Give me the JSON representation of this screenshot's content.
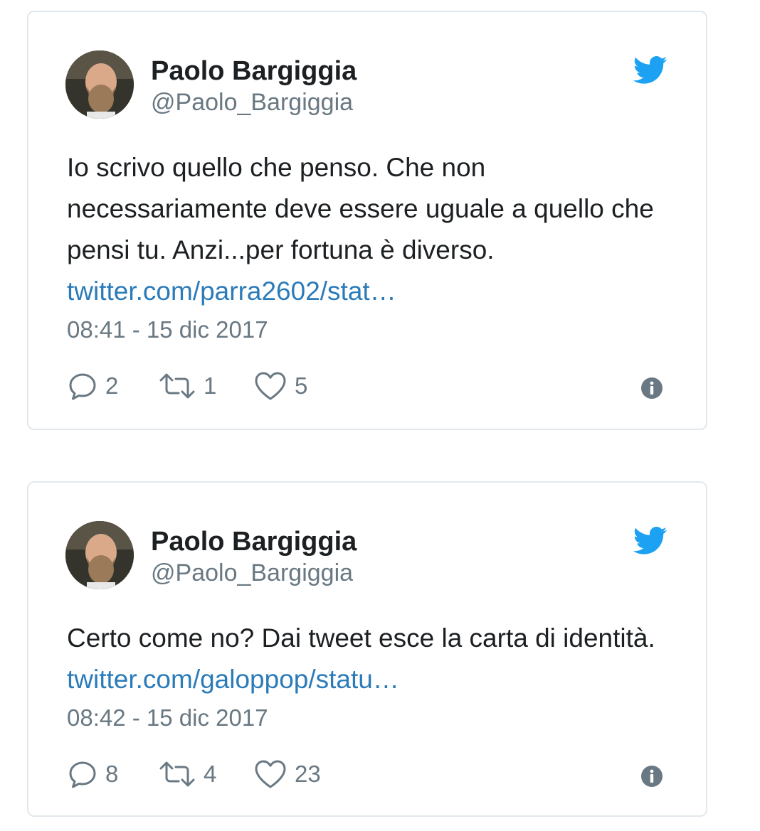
{
  "colors": {
    "link": "#2b7bb9",
    "muted": "#697882",
    "twitter_blue": "#1da1f2",
    "border": "#e1e8ed"
  },
  "tweets": [
    {
      "author": {
        "name": "Paolo Bargiggia",
        "handle": "@Paolo_Bargiggia"
      },
      "text": "Io scrivo quello che penso. Che non necessariamente deve essere uguale a quello che pensi tu. Anzi...per fortuna è diverso.",
      "link": "twitter.com/parra2602/stat…",
      "timestamp": "08:41 - 15 dic 2017",
      "replies": "2",
      "retweets": "1",
      "likes": "5",
      "icons": {
        "brand": "twitter-bird-icon",
        "reply": "reply-bubble-icon",
        "retweet": "retweet-icon",
        "like": "heart-icon",
        "info": "info-icon"
      }
    },
    {
      "author": {
        "name": "Paolo Bargiggia",
        "handle": "@Paolo_Bargiggia"
      },
      "text": "Certo come no? Dai tweet esce la carta di identità.",
      "link": "twitter.com/galoppop/statu…",
      "timestamp": "08:42 - 15 dic 2017",
      "replies": "8",
      "retweets": "4",
      "likes": "23",
      "icons": {
        "brand": "twitter-bird-icon",
        "reply": "reply-bubble-icon",
        "retweet": "retweet-icon",
        "like": "heart-icon",
        "info": "info-icon"
      }
    }
  ]
}
